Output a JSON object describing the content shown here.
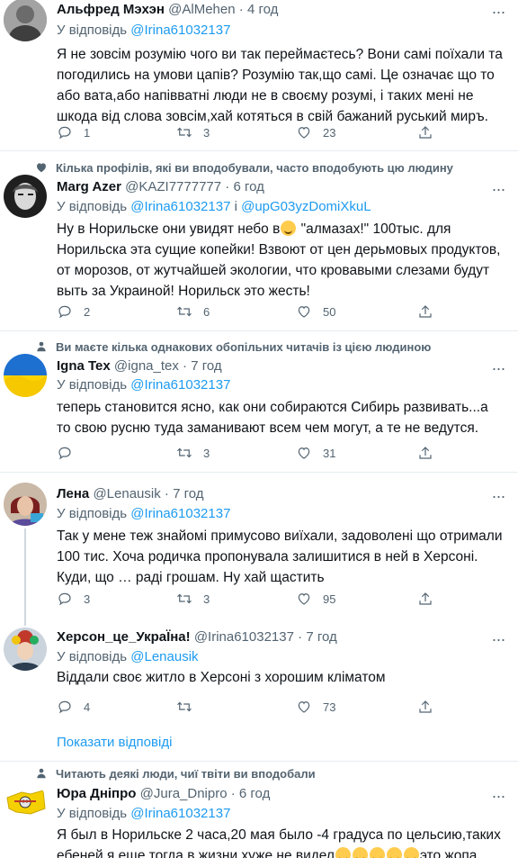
{
  "tweets": [
    {
      "name": "Альфред Мэхэн",
      "handle": "@AlMehen",
      "sep": " · ",
      "time": "4 год",
      "reply_prefix": "У відповідь ",
      "reply_to": "@Irina61032137",
      "text": "Я не зовсім розумію чого ви так переймаєтесь? Вони самі поїхали та погодились на умови цапів? Розумію так,що самі. Це означає що то або вата,або напівватні люди не в своєму розумі, і таких мені не шкода від слова зовсім,хай котяться в свій бажаний руський миръ.",
      "replies": "1",
      "retweets": "3",
      "likes": "23"
    },
    {
      "social": "Кілька профілів, які ви вподобували, часто вподобують цю людину",
      "social_icon": "heart-icon",
      "name": "Marg Azer",
      "handle": "@KAZI7777777",
      "sep": " · ",
      "time": "6 год",
      "reply_prefix": "У відповідь ",
      "reply_to": "@Irina61032137",
      "reply_and": " і ",
      "reply_to2": "@upG03yzDomiXkuL",
      "text_a": "Ну в Норильске они увидят небо в",
      "text_b": "  \"алмазах!\" 100тыс. для Норильска эта сущие копейки! Взвоют от цен дерьмовых продуктов, от морозов, от жутчайшей экологии, что кровавыми слезами будут выть за Украиной! Норильск это жесть!",
      "replies": "2",
      "retweets": "6",
      "likes": "50"
    },
    {
      "social": "Ви маєте кілька однакових обопільних читачів із цією людиною",
      "social_icon": "person-icon",
      "name": "Igna Tex",
      "handle": "@igna_tex",
      "sep": " · ",
      "time": "7 год",
      "reply_prefix": "У відповідь ",
      "reply_to": "@Irina61032137",
      "text": "теперь становится ясно, как они собираются Сибирь развивать...а то свою русню туда заманивают всем чем могут, а те не ведутся.",
      "replies": "",
      "retweets": "3",
      "likes": "31"
    },
    {
      "name": "Лена",
      "handle": "@Lenausik",
      "sep": " · ",
      "time": "7 год",
      "reply_prefix": "У відповідь ",
      "reply_to": "@Irina61032137",
      "text": "Так у мене теж знайомі примусово виїхали, задоволені що отримали 100 тис. Хоча родичка пропонувала залишитися в ней в Херсоні. Куди, що … раді грошам. Ну хай щастить",
      "replies": "3",
      "retweets": "3",
      "likes": "95"
    },
    {
      "name": "Херсон_це_УкраЇна!",
      "handle": "@Irina61032137",
      "sep": " · ",
      "time": "7 год",
      "reply_prefix": "У відповідь ",
      "reply_to": "@Lenausik",
      "text": "Віддали своє житло в Херсоні з хорошим кліматом",
      "replies": "4",
      "retweets": "",
      "likes": "73"
    },
    {
      "social": "Читають деякі люди, чиї твіти ви вподобали",
      "social_icon": "person-icon",
      "name": "Юра Дніпро",
      "handle": "@Jura_Dnipro",
      "sep": " · ",
      "time": "6 год",
      "reply_prefix": "У відповідь ",
      "reply_to": "@Irina61032137",
      "text_a": "Я был в Норильске 2 часа,20 мая было -4 градуса по цельсию,таких ебеней я еще тогда в жизни хуже не видел",
      "text_b": "это жопа"
    }
  ],
  "show_replies": "Показати відповіді",
  "colors": {
    "accent": "#1d9bf0",
    "muted": "#536471",
    "text": "#0f1419",
    "border": "#e6ecf0"
  }
}
